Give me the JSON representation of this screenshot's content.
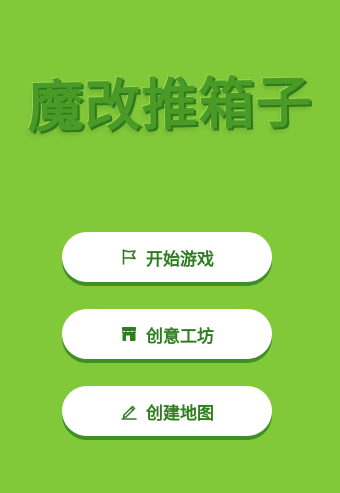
{
  "game": {
    "title": "魔改推箱子"
  },
  "menu": {
    "items": [
      {
        "label": "开始游戏",
        "icon": "flag-icon"
      },
      {
        "label": "创意工坊",
        "icon": "shop-icon"
      },
      {
        "label": "创建地图",
        "icon": "pencil-icon"
      }
    ]
  },
  "colors": {
    "background": "#82c93a",
    "title": "#4a9a28",
    "button": "#ffffff",
    "button_text": "#2e7d1e",
    "button_shadow": "#3e8f24"
  }
}
